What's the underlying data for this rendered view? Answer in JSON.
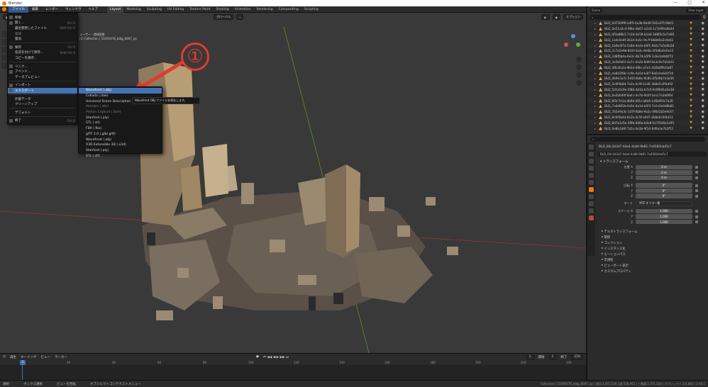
{
  "window": {
    "title": "Blender",
    "controls": [
      "—",
      "□",
      "✕"
    ]
  },
  "menubar": {
    "menus": [
      "ファイル",
      "編集",
      "レンダー",
      "ウィンドウ",
      "ヘルプ"
    ],
    "workspaces": [
      "Layout",
      "Modeling",
      "Sculpting",
      "UV Editing",
      "Texture Paint",
      "Shading",
      "Animation",
      "Rendering",
      "Compositing",
      "Scripting"
    ]
  },
  "viewport": {
    "mode": "Object Mode",
    "view_menu": "ビュー",
    "select_menu": "選択",
    "add_menu": "追加",
    "object_menu": "オブジェクト",
    "global": "グローバル",
    "options": "オプション",
    "info_line": "ユーザー・透視投影",
    "collection_line": "(1) Collection | 53391676_bldg_6697_op"
  },
  "file_menu": {
    "items": [
      {
        "label": "新規",
        "shortcut": "",
        "icon": "new-file-icon"
      },
      {
        "label": "開く...",
        "shortcut": "Ctrl O",
        "icon": "folder-icon"
      },
      {
        "label": "最近使用したファイル",
        "shortcut": "Shift Ctrl O",
        "icon": ""
      },
      {
        "label": "復帰",
        "shortcut": "",
        "icon": "",
        "dim": true
      },
      {
        "label": "復旧",
        "shortcut": "",
        "icon": ""
      },
      {
        "sep": true
      },
      {
        "label": "保存",
        "shortcut": "Ctrl S",
        "icon": "save-icon"
      },
      {
        "label": "名前を付けて保存...",
        "shortcut": "Shift Ctrl S",
        "icon": ""
      },
      {
        "label": "コピーを保存...",
        "shortcut": "",
        "icon": ""
      },
      {
        "sep": true
      },
      {
        "label": "リンク...",
        "shortcut": "",
        "icon": "link-icon"
      },
      {
        "label": "アペンド...",
        "shortcut": "",
        "icon": "append-icon"
      },
      {
        "label": "データプレビュー",
        "shortcut": "",
        "icon": ""
      },
      {
        "sep": true
      },
      {
        "label": "インポート",
        "shortcut": "",
        "icon": "import-icon"
      },
      {
        "label": "エクスポート",
        "shortcut": "",
        "icon": "export-icon",
        "highlight": true
      },
      {
        "sep": true
      },
      {
        "label": "外部データ",
        "shortcut": "",
        "icon": ""
      },
      {
        "label": "クリーンアップ",
        "shortcut": "",
        "icon": ""
      },
      {
        "sep": true
      },
      {
        "label": "デフォルト",
        "shortcut": "",
        "icon": ""
      },
      {
        "sep": true
      },
      {
        "label": "終了",
        "shortcut": "Ctrl Q",
        "icon": "quit-icon"
      }
    ]
  },
  "export_menu": {
    "items": [
      {
        "label": "Wavefront (.obj)",
        "highlight": true
      },
      {
        "label": "Collada (.dae)"
      },
      {
        "label": "Universal Scene Description (.usd, .usdc, .usda)"
      },
      {
        "label": "Alembic (.abc)",
        "dim": true
      },
      {
        "label": "Motion Capture (.bvh)",
        "dim": true
      },
      {
        "label": "Stanford (.ply)"
      },
      {
        "label": "STL (.stl)"
      },
      {
        "label": "FBX (.fbx)"
      },
      {
        "label": "glTF 2.0 (.glb/.gltf)"
      },
      {
        "label": "Wavefront (.obj)"
      },
      {
        "label": "X3D Extensible 3D (.x3d)"
      },
      {
        "label": "Stanford (.ply)"
      },
      {
        "label": "STL (.stl)"
      }
    ],
    "tooltip": "Wavefront OBJ ファイルを保存します。"
  },
  "annotation": {
    "number": "①"
  },
  "timeline": {
    "labels": [
      "再生",
      "キーイング",
      "ビュー",
      "マーカー"
    ],
    "current_frame": "1",
    "start_label": "開始",
    "start": "1",
    "end_label": "終了",
    "end": "250",
    "ticks": [
      "0",
      "20",
      "40",
      "60",
      "80",
      "100",
      "120",
      "140",
      "160",
      "180",
      "200",
      "220",
      "240"
    ]
  },
  "statusbar": {
    "select": "選択",
    "box_select": "ボックス選択",
    "rotate": "ビューを回転",
    "context": "オブジェクトコンテクストメニュー",
    "stats": "Collection | 53391676_bldg_6697_op | 頂点:1,071,520 | 面:558,952 | 三角面:1,071,520 | オブジェクト:1/1,082 | 2.93.1"
  },
  "outliner": {
    "search_placeholder": "",
    "view_layer": "View Layer",
    "scene": "Scene",
    "rows": [
      "BLD_0d7169f6-e4f5-4a3b-8a40-5d1e2f7c9b01",
      "BLD_0e51d2c4-9f8a-4b67-a2d3-1c7e9f0a6b44",
      "BLD_0f3a88b1-7c2d-4e59-b1a6-3d8f2c5e7a90",
      "BLD_1a4c6e8f-2b3d-4a5c-9e7f-6b8d0a2c4e61",
      "BLD_1b9e3f7a-5c8d-4e2a-b6f1-9d3c7a5e0b28",
      "BLD_2c7a5e9b-8d1f-4a3c-9e6b-2f4d8a0c6e15",
      "BLD_2d8f0b4a-6e3c-4b7d-a5f9-1c6e3a8d0f72",
      "BLD_3e5b9d1f-4a7c-4e2b-8d6f-0a3c9e7b5d43",
      "BLD_3f6c0e2a-9b5d-4f8c-a7e1-4d2b6f9c0a87",
      "BLD_4a8d2f6b-1c9e-4a5d-b3f7-8e0c4a6d2f19",
      "BLD_4b9e3a7c-5d1f-4b6e-9c8a-2f5d0b7e3a56",
      "BLD_5c0f4b8d-7e2a-4c9f-a1d6-3b8e5c0f4d92",
      "BLD_5d1a5c9e-2f8b-4d3a-b7e5-9c0f6d1a5e38",
      "BLD_6e2b6d0f-8a4c-4e7b-9d3f-5a1c7e2b6f64",
      "BLD_6f3c7e1a-4b9d-4f2c-a8e6-1d5b9f3c7a20",
      "BLD_7a4d8f2b-9c6e-4a1d-b5f3-7e2c0a4d8b81",
      "BLD_7b5e9a3c-1d7f-4b8e-9a2c-4f6d1b5e9c47",
      "BLD_8c6f0b4d-6e3a-4c5f-a9d7-2b8e6c0f4d13",
      "BLD_8d7a1c5e-3f9b-4d6a-b4e8-0c7f2d6a1e95",
      "BLD_9e8b2d6f-7a5c-4e3b-9f1d-6d9a3e7b2f52"
    ]
  },
  "properties": {
    "object_name": "BLD_00c3d3d7-4da4-4c84-9b81-7e4560cbd5c7",
    "data_name": "BLD_00c3d3d7-4da4-4c84-9b81-7e4560cbd5c7",
    "transform_header": "トランスフォーム",
    "location_label": "位置 X",
    "rotation_label": "回転 X",
    "scale_label": "スケール X",
    "mode_label": "モード",
    "mode_value": "XYZ オイラー角",
    "y_label": "Y",
    "z_label": "Z",
    "loc": [
      "0 m",
      "0 m",
      "0 m"
    ],
    "rot": [
      "0°",
      "0°",
      "0°"
    ],
    "scale": [
      "1.000",
      "1.000",
      "1.000"
    ],
    "panels": [
      "デルタトランスフォーム",
      "関係",
      "コレクション",
      "インスタンス化",
      "モーションパス",
      "可視性",
      "ビューポート表示",
      "カスタムプロパティ"
    ]
  },
  "colors": {
    "accent": "#4772b3",
    "annotation": "#e23b2a",
    "blender_orange": "#e87d0d"
  }
}
